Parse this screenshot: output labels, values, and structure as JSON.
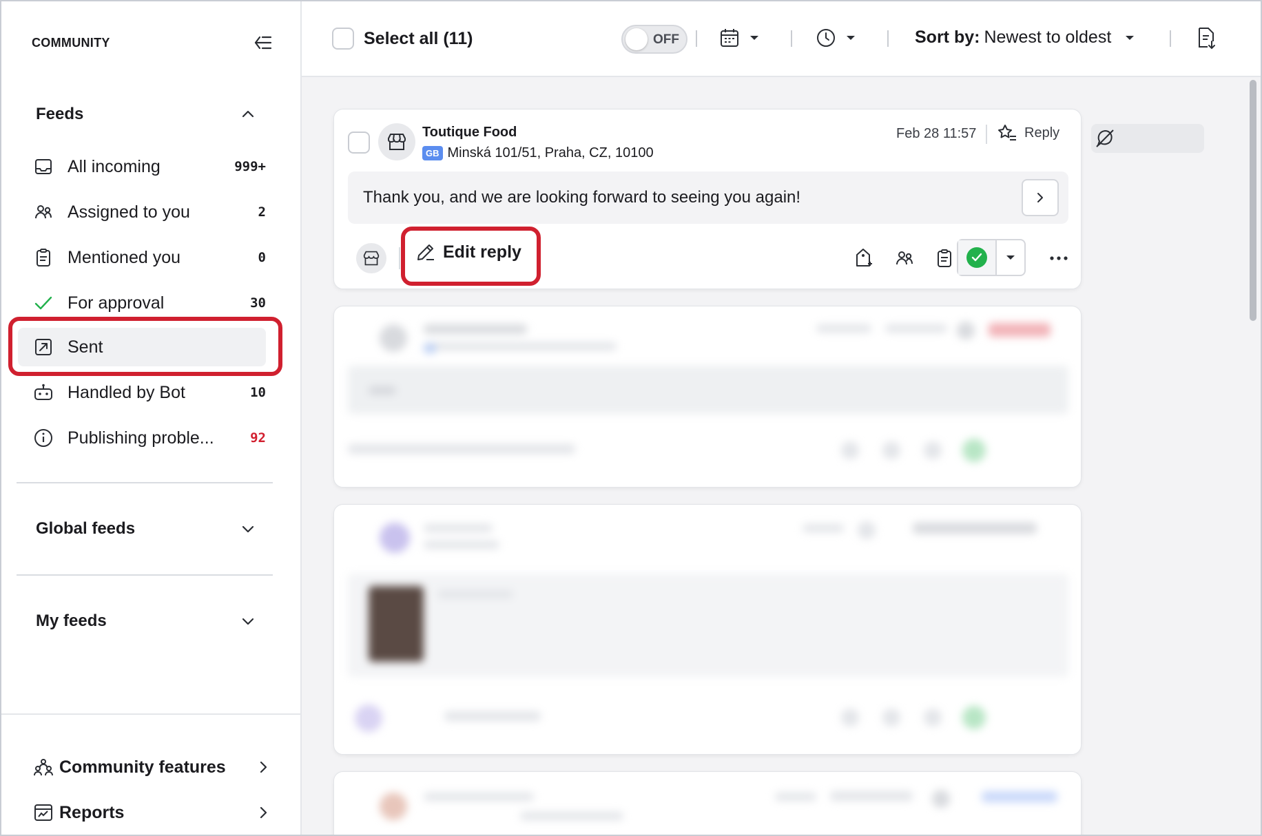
{
  "sidebar": {
    "title": "COMMUNITY",
    "feeds_label": "Feeds",
    "items": [
      {
        "label": "All incoming",
        "count": "999+",
        "icon": "inbox-icon"
      },
      {
        "label": "Assigned to you",
        "count": "2",
        "icon": "users-icon"
      },
      {
        "label": "Mentioned you",
        "count": "0",
        "icon": "clipboard-icon"
      },
      {
        "label": "For approval",
        "count": "30",
        "icon": "check-icon"
      },
      {
        "label": "Sent",
        "count": "",
        "icon": "sent-icon"
      },
      {
        "label": "Handled by Bot",
        "count": "10",
        "icon": "bot-icon"
      },
      {
        "label": "Publishing proble...",
        "count": "92",
        "icon": "info-icon"
      }
    ],
    "global_feeds_label": "Global feeds",
    "my_feeds_label": "My feeds",
    "bottom": [
      {
        "label": "Community features",
        "icon": "community-features-icon"
      },
      {
        "label": "Reports",
        "icon": "reports-icon"
      }
    ]
  },
  "toolbar": {
    "select_all": "Select all (11)",
    "toggle_text": "OFF",
    "sort_prefix": "Sort by:",
    "sort_value": "Newest to oldest"
  },
  "post": {
    "author": "Toutique Food",
    "language": "GB",
    "location": "Minská 101/51, Praha, CZ, 10100",
    "date": "Feb 28 11:57",
    "reply_label": "Reply",
    "message": "Thank you, and we are looking forward to seeing you again!",
    "edit_reply_label": "Edit reply"
  },
  "colors": {
    "highlight": "#d0202f",
    "approved": "#22b14c",
    "count_alert": "#d21f2f",
    "lang_badge": "#5b8def"
  }
}
